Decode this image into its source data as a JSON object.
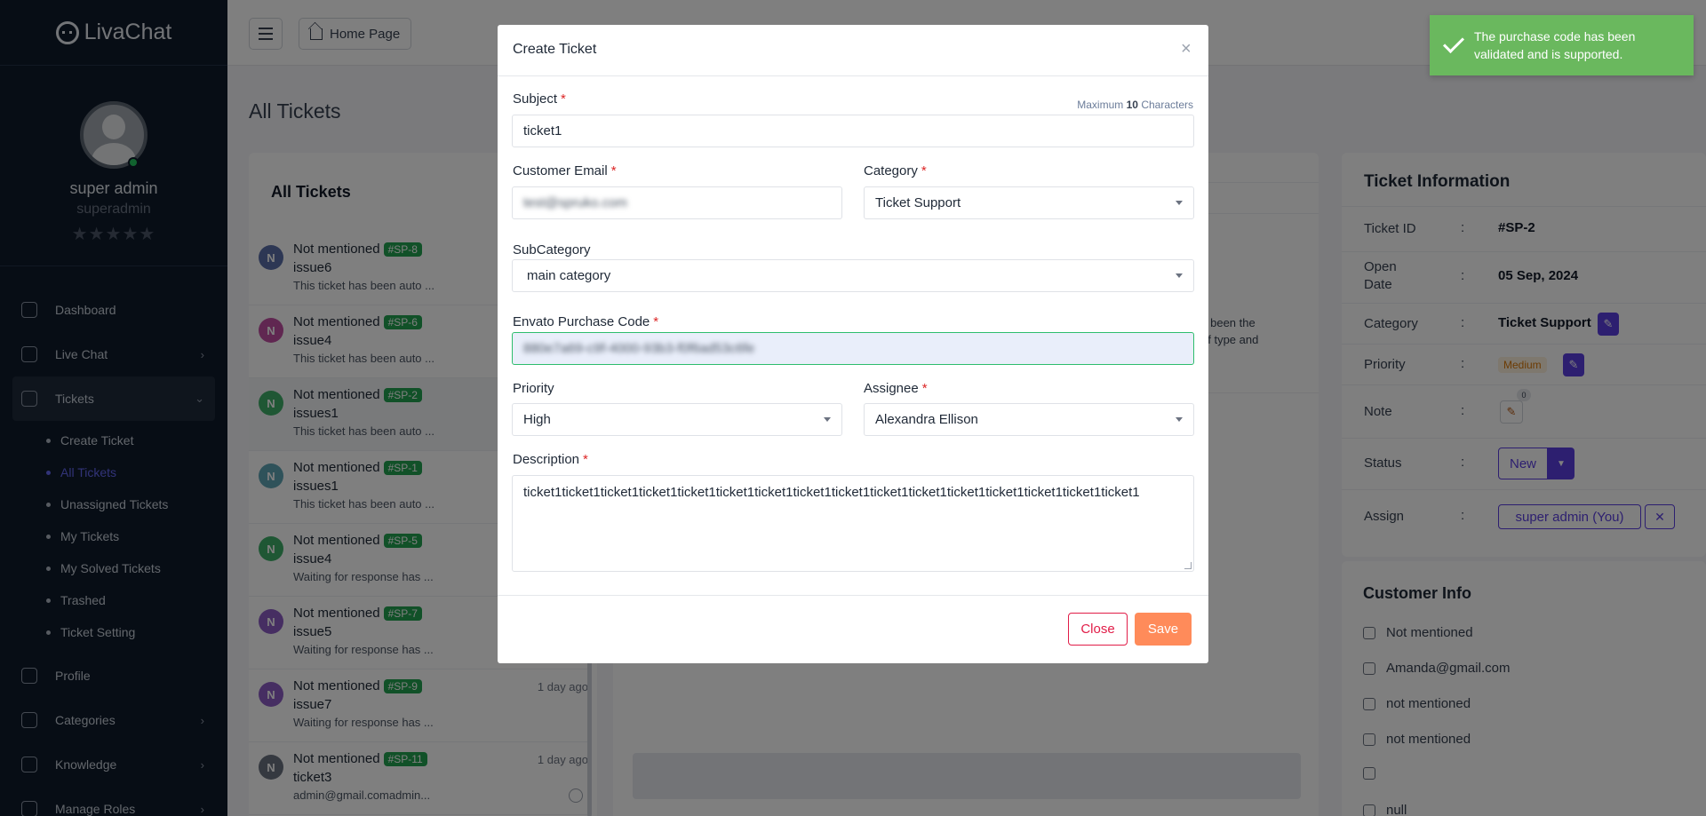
{
  "app": {
    "name": "LivaChat"
  },
  "sidebar": {
    "user_name": "super admin",
    "user_role": "superadmin",
    "rating": "★★★★★",
    "items": [
      {
        "label": "Dashboard"
      },
      {
        "label": "Live Chat"
      },
      {
        "label": "Tickets"
      },
      {
        "label": "Profile"
      },
      {
        "label": "Categories"
      },
      {
        "label": "Knowledge"
      },
      {
        "label": "Manage Roles"
      }
    ],
    "ticket_sub": [
      "Create Ticket",
      "All Tickets",
      "Unassigned Tickets",
      "My Tickets",
      "My Solved Tickets",
      "Trashed",
      "Ticket Setting"
    ]
  },
  "topbar": {
    "home_label": "Home Page"
  },
  "page_title": "All Tickets",
  "tickets": {
    "title": "All Tickets",
    "items": [
      {
        "avatar": "N",
        "color": "#5b6fa8",
        "name": "Not mentioned",
        "id": "#SP-8",
        "subject": "issue6",
        "snippet": "This ticket has been auto ...",
        "time": ""
      },
      {
        "avatar": "N",
        "color": "#c04fa3",
        "name": "Not mentioned",
        "id": "#SP-6",
        "subject": "issue4",
        "snippet": "This ticket has been auto ...",
        "time": ""
      },
      {
        "avatar": "N",
        "color": "#3fae68",
        "name": "Not mentioned",
        "id": "#SP-2",
        "subject": "issues1",
        "snippet": "This ticket has been auto ...",
        "time": ""
      },
      {
        "avatar": "N",
        "color": "#5fa5b5",
        "name": "Not mentioned",
        "id": "#SP-1",
        "subject": "issues1",
        "snippet": "This ticket has been auto ...",
        "time": ""
      },
      {
        "avatar": "N",
        "color": "#3fae68",
        "name": "Not mentioned",
        "id": "#SP-5",
        "subject": "issue4",
        "snippet": "Waiting for response has ...",
        "time": ""
      },
      {
        "avatar": "N",
        "color": "#8d5cc4",
        "name": "Not mentioned",
        "id": "#SP-7",
        "subject": "issue5",
        "snippet": "Waiting for response has ...",
        "time": ""
      },
      {
        "avatar": "N",
        "color": "#8d5cc4",
        "name": "Not mentioned",
        "id": "#SP-9",
        "subject": "issue7",
        "snippet": "Waiting for response has ...",
        "time": "1 day ago"
      },
      {
        "avatar": "N",
        "color": "#6b7280",
        "name": "Not mentioned",
        "id": "#SP-11",
        "subject": "ticket3",
        "snippet": "admin@gmail.comadmin...",
        "time": "1 day ago"
      }
    ]
  },
  "chat": {
    "frag1": "s been the",
    "frag2": "of type and"
  },
  "ticket_info": {
    "title": "Ticket Information",
    "id_label": "Ticket ID",
    "id_value": "#SP-2",
    "open_label": "Open Date",
    "open_value": "05 Sep, 2024",
    "category_label": "Category",
    "category_value": "Ticket Support",
    "priority_label": "Priority",
    "priority_value": "Medium",
    "note_label": "Note",
    "note_count": "0",
    "status_label": "Status",
    "status_value": "New",
    "assign_label": "Assign",
    "assign_value": "super admin (You)",
    "colon": ":"
  },
  "customer_info": {
    "title": "Customer Info",
    "name": "Not mentioned",
    "email": "Amanda@gmail.com",
    "phone": "not mentioned",
    "device": "not mentioned",
    "location": "",
    "other": "null"
  },
  "modal": {
    "title": "Create Ticket",
    "close_symbol": "×",
    "subject_label": "Subject",
    "subject_hint_prefix": "Maximum",
    "subject_hint_num": "10",
    "subject_hint_suffix": "Characters",
    "subject_value": "ticket1",
    "email_label": "Customer Email",
    "email_value": "test@spruko.com",
    "category_label": "Category",
    "category_value": "Ticket Support",
    "subcategory_label": "SubCategory",
    "subcategory_value": "main category",
    "purchase_label": "Envato Purchase Code",
    "purchase_value": "880e7a69-c9f-4000-93b3-f0f6ad53c6fe",
    "priority_label": "Priority",
    "priority_value": "High",
    "assignee_label": "Assignee",
    "assignee_value": "Alexandra Ellison",
    "description_label": "Description",
    "description_value": "ticket1ticket1ticket1ticket1ticket1ticket1ticket1ticket1ticket1ticket1ticket1ticket1ticket1ticket1ticket1ticket1",
    "required_mark": "*",
    "close_button": "Close",
    "save_button": "Save"
  },
  "toast": {
    "message": "The purchase code has been validated and is supported.",
    "color": "#6ab85e"
  }
}
